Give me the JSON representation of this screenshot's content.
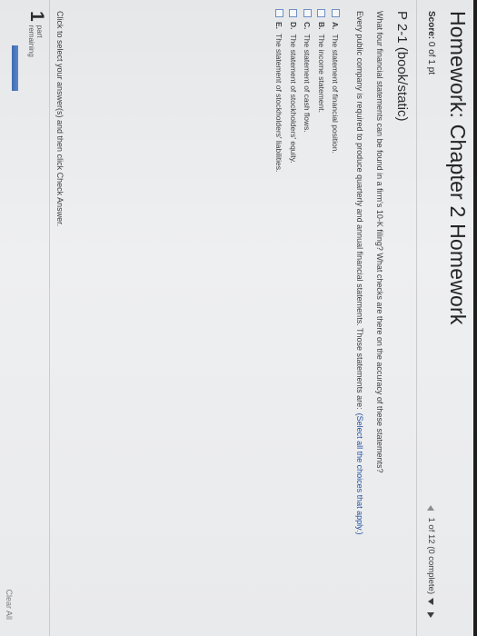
{
  "header": {
    "title": "Homework: Chapter 2 Homework",
    "score_label": "Score:",
    "score_value": "0 of 1 pt",
    "question_counter": "1 of 12 (0 complete)"
  },
  "problem": {
    "title": "P 2-1 (book/static)",
    "question": "What four financial statements can be found in a firm's 10-K filing? What checks are there on the accuracy of these statements?",
    "instruction": "Every public company is required to produce quarterly and annual financial statements. Those statements are:",
    "select_hint": "(Select all the choices that apply.)",
    "choices": [
      {
        "letter": "A.",
        "text": "The statement of financial position."
      },
      {
        "letter": "B.",
        "text": "The income statement."
      },
      {
        "letter": "C.",
        "text": "The statement of cash flows."
      },
      {
        "letter": "D.",
        "text": "The statement of stockholders' equity."
      },
      {
        "letter": "E.",
        "text": "The statement of stockholders' liabilities."
      }
    ]
  },
  "footer": {
    "note": "Click to select your answer(s) and then click Check Answer.",
    "parts_count": "1",
    "parts_label_line1": "part",
    "parts_label_line2": "remaining",
    "progress_fraction": 1.0,
    "clear_all": "Clear All"
  },
  "colors": {
    "accent": "#3e6bb3",
    "link": "#1f4f9e"
  },
  "icons": [
    "prev-question-icon",
    "question-list-dropdown-icon",
    "next-question-icon",
    "checkbox-icon"
  ]
}
